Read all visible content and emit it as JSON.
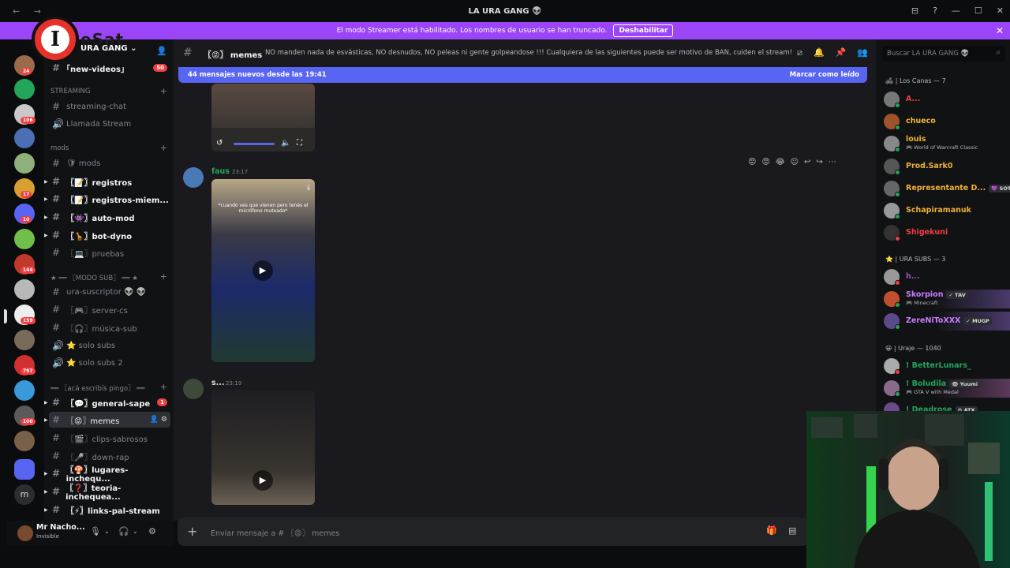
{
  "window": {
    "title": "LA URA GANG 👽",
    "controls": [
      "⊟",
      "?",
      "—",
      "☐",
      "✕"
    ]
  },
  "banner": {
    "text": "El modo Streamer está habilitado. Los nombres de usuario se han truncado.",
    "button": "Deshabilitar"
  },
  "rail_badges": [
    "24",
    "106",
    "17",
    "10",
    "144",
    "159",
    "797",
    "100"
  ],
  "server": {
    "name": "URA GANG",
    "chevron": "⌄"
  },
  "sidebar": {
    "top_channel": "｢new-videos｣",
    "top_channel_badge": "50",
    "categories": {
      "streaming": "STREAMING",
      "mods": "mods",
      "modo_sub": "★ ══ 〖MODO SUB〗 ══ ★",
      "aca": "══ 〖acá escribís pingo〗 ══"
    },
    "channels": [
      {
        "label": "streaming-chat",
        "kind": "text"
      },
      {
        "label": "Llamada Stream",
        "kind": "voice"
      },
      {
        "label": "🛡 mods",
        "kind": "text"
      },
      {
        "label": "〖📝〗registros",
        "kind": "text"
      },
      {
        "label": "〖📝〗registros-miem...",
        "kind": "text"
      },
      {
        "label": "〖👾〗auto-mod",
        "kind": "text"
      },
      {
        "label": "〖🦒〗bot-dyno",
        "kind": "text"
      },
      {
        "label": "〖💻〗pruebas",
        "kind": "text"
      },
      {
        "label": "ura-suscriptor 👽 👽",
        "kind": "text"
      },
      {
        "label": "〖🎮〗server-cs",
        "kind": "text"
      },
      {
        "label": "〖🎧〗música-sub",
        "kind": "text"
      },
      {
        "label": "⭐ solo subs",
        "kind": "voice"
      },
      {
        "label": "⭐ solo subs 2",
        "kind": "voice"
      },
      {
        "label": "〖💬〗general-sape",
        "kind": "text",
        "badge": "1"
      },
      {
        "label": "〖😡〗memes",
        "kind": "text"
      },
      {
        "label": "〖🎬〗clips-sabrosos",
        "kind": "text"
      },
      {
        "label": "〖🎤〗down-rap",
        "kind": "text"
      },
      {
        "label": "〖🍄〗lugares-inchequ...",
        "kind": "text"
      },
      {
        "label": "〖❓〗teoria-inchequea...",
        "kind": "text"
      },
      {
        "label": "〖⚡〗links-pal-stream",
        "kind": "text"
      }
    ]
  },
  "user": {
    "name": "Mr Nacho...",
    "status": "Invisible"
  },
  "chat": {
    "channel": "〖😡〗 memes",
    "topic": "NO manden nada de esvásticas, NO desnudos, NO peleas ni gente golpeandose !!! Cualquiera de las siguientes puede ser motivo de BAN, cuiden el stream!",
    "new_messages": "44 mensajes nuevos desde las 19:41",
    "mark_read": "Marcar como leído",
    "messages": [
      {
        "author": "faus",
        "time": "23:17",
        "caption": "*cuando ves que vienen pero tenés el micrófono muteado*"
      },
      {
        "author": "s...",
        "time": "23:19"
      }
    ],
    "composer_placeholder": "Enviar mensaje a # 〖😡〗 memes"
  },
  "members": {
    "search_placeholder": "Buscar LA URA GANG 👽",
    "groups": [
      {
        "title": "🛋 | Los Canas — 7",
        "items": [
          {
            "name": "A...",
            "color": "#f23f43",
            "status": "#23a55a"
          },
          {
            "name": "chueco",
            "color": "#f0b232",
            "status": "#23a55a"
          },
          {
            "name": "louis",
            "color": "#f0b232",
            "sub": "🎮 World of Warcraft Classic",
            "status": "#23a55a"
          },
          {
            "name": "Prod.Sark0",
            "color": "#f0b232",
            "status": "#23a55a"
          },
          {
            "name": "Representante D...",
            "color": "#f0b232",
            "tag": "💜 SOTE",
            "status": "#23a55a"
          },
          {
            "name": "Schapiramanuk",
            "color": "#f0b232",
            "status": "#23a55a"
          },
          {
            "name": "Shigekuni",
            "color": "#f23f43",
            "status": "#f23f43"
          }
        ]
      },
      {
        "title": "⭐ | URA SUBS — 3",
        "items": [
          {
            "name": "h...",
            "color": "#9b59b6",
            "status": "#f23f43"
          },
          {
            "name": "Skorpion",
            "color": "#c77dff",
            "sub": "🎮 Minecraft",
            "tag": "✓ TAV",
            "status": "#23a55a"
          },
          {
            "name": "ZereNiToXXX",
            "color": "#c77dff",
            "tag": "✓ MUGP",
            "status": "#23a55a"
          }
        ]
      },
      {
        "title": "😀 | Uraje — 1040",
        "items": [
          {
            "name": "! BetterLunars_",
            "color": "#23a55a",
            "status": "#f23f43"
          },
          {
            "name": "! Boludila",
            "color": "#23a55a",
            "sub": "🎮 GTA V with Medal",
            "tag": "👁 Yuumi",
            "status": "#23a55a"
          },
          {
            "name": "! Deadrose",
            "color": "#23a55a",
            "tag": "⚙ ATX",
            "status": "#23a55a"
          }
        ]
      }
    ]
  },
  "overlay": {
    "logo_letter": "I",
    "logo_text": "eSat"
  }
}
